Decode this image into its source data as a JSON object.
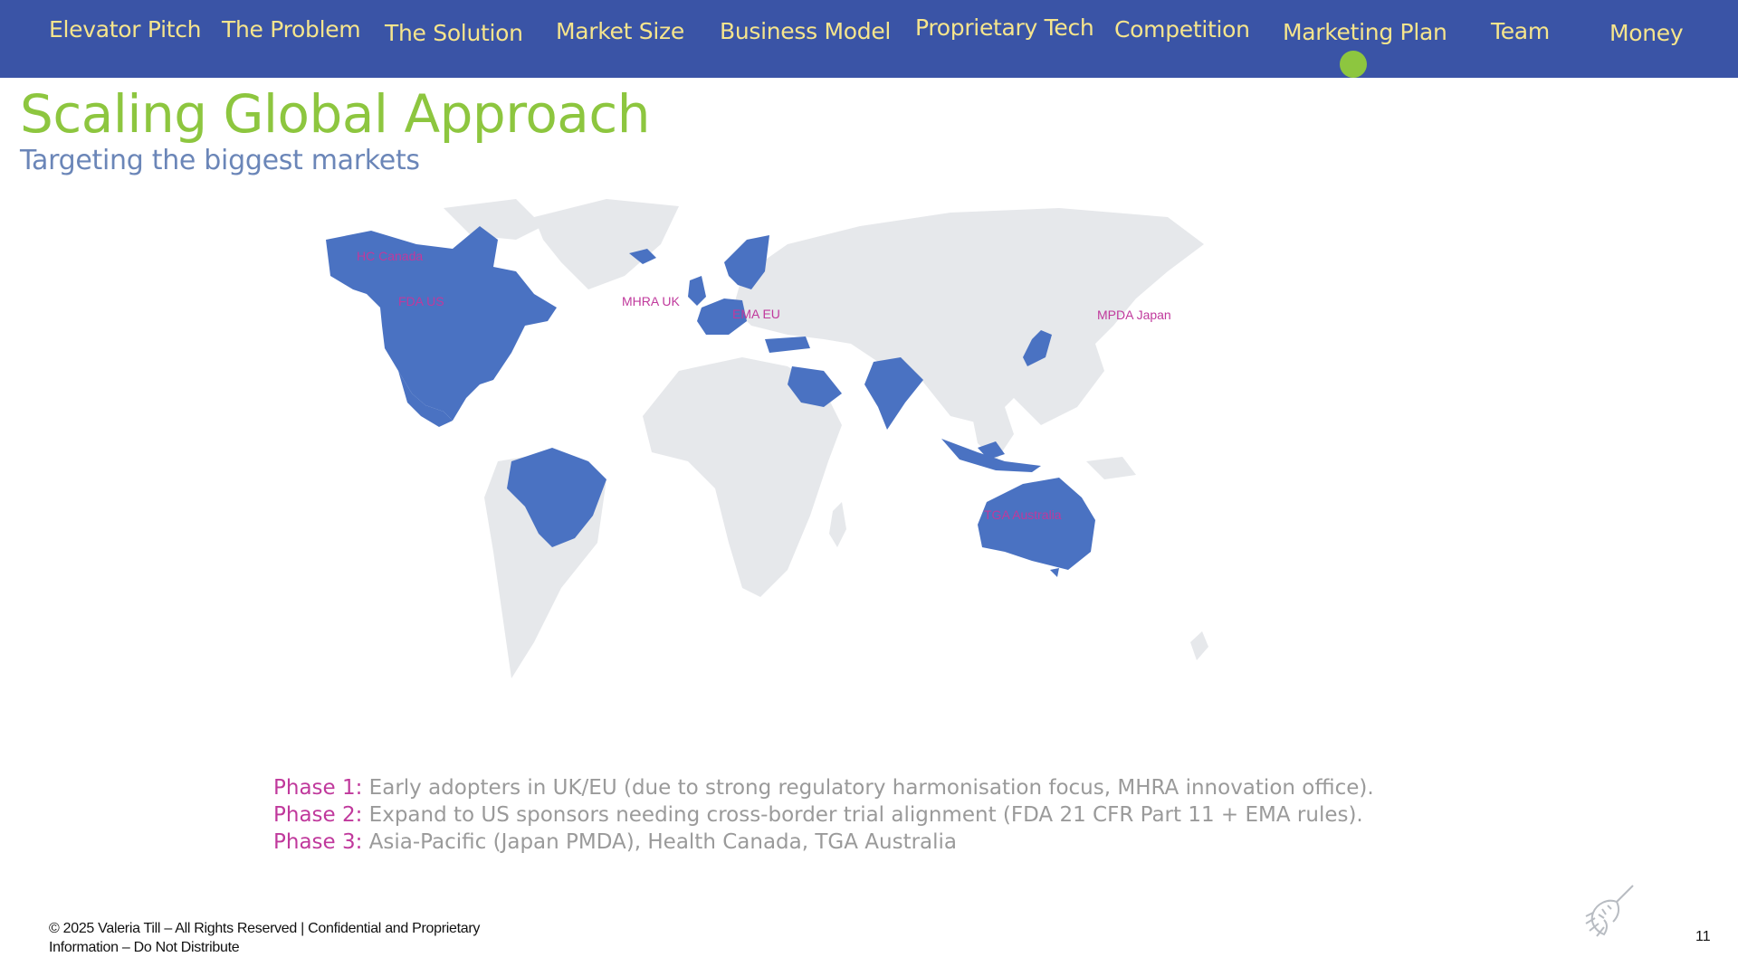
{
  "nav": {
    "items": [
      {
        "label": "Elevator Pitch"
      },
      {
        "label": "The Problem"
      },
      {
        "label": "The Solution"
      },
      {
        "label": "Market Size"
      },
      {
        "label": "Business Model"
      },
      {
        "label": "Proprietary Tech"
      },
      {
        "label": "Competition"
      },
      {
        "label": "Marketing Plan",
        "active": true
      },
      {
        "label": "Team"
      },
      {
        "label": "Money"
      }
    ],
    "active_indicator_color": "#8dc63f",
    "background_color": "#3a54a6",
    "text_color": "#f6e58c"
  },
  "slide": {
    "title": "Scaling Global Approach",
    "subtitle": "Targeting the biggest markets",
    "title_color": "#8dc63f",
    "subtitle_color": "#6b86b8"
  },
  "map": {
    "highlight_color": "#4a72c2",
    "base_color": "#e6e8eb",
    "label_color": "#c0399c",
    "labels": [
      {
        "text": "HC Canada"
      },
      {
        "text": "FDA US"
      },
      {
        "text": "MHRA UK"
      },
      {
        "text": "EMA EU"
      },
      {
        "text": "MPDA Japan"
      },
      {
        "text": "TGA Australia"
      }
    ],
    "highlighted_regions": [
      "Canada",
      "United States",
      "Mexico",
      "Brazil",
      "United Kingdom",
      "Ireland",
      "France",
      "Germany",
      "Benelux",
      "Scandinavia",
      "Finland",
      "Turkey",
      "Saudi Arabia",
      "India",
      "Japan",
      "Indonesia",
      "Australia",
      "Iceland"
    ]
  },
  "phases": [
    {
      "label": "Phase 1",
      "sep": ":",
      "text": " Early adopters in UK/EU (due to strong regulatory harmonisation focus, MHRA innovation office)."
    },
    {
      "label": "Phase 2",
      "sep": ":",
      "text": " Expand to US sponsors needing cross-border trial alignment (FDA 21 CFR Part 11 + EMA rules)."
    },
    {
      "label": "Phase 3",
      "sep": ":",
      "text": " Asia-Pacific (Japan PMDA), Health Canada, TGA Australia"
    }
  ],
  "footer": {
    "line1": "© 2025 Valeria Till – All Rights Reserved | Confidential and Proprietary",
    "line2": "Information – Do Not Distribute",
    "page_number": "11",
    "logo_icon": "unicorn-logo-icon"
  }
}
